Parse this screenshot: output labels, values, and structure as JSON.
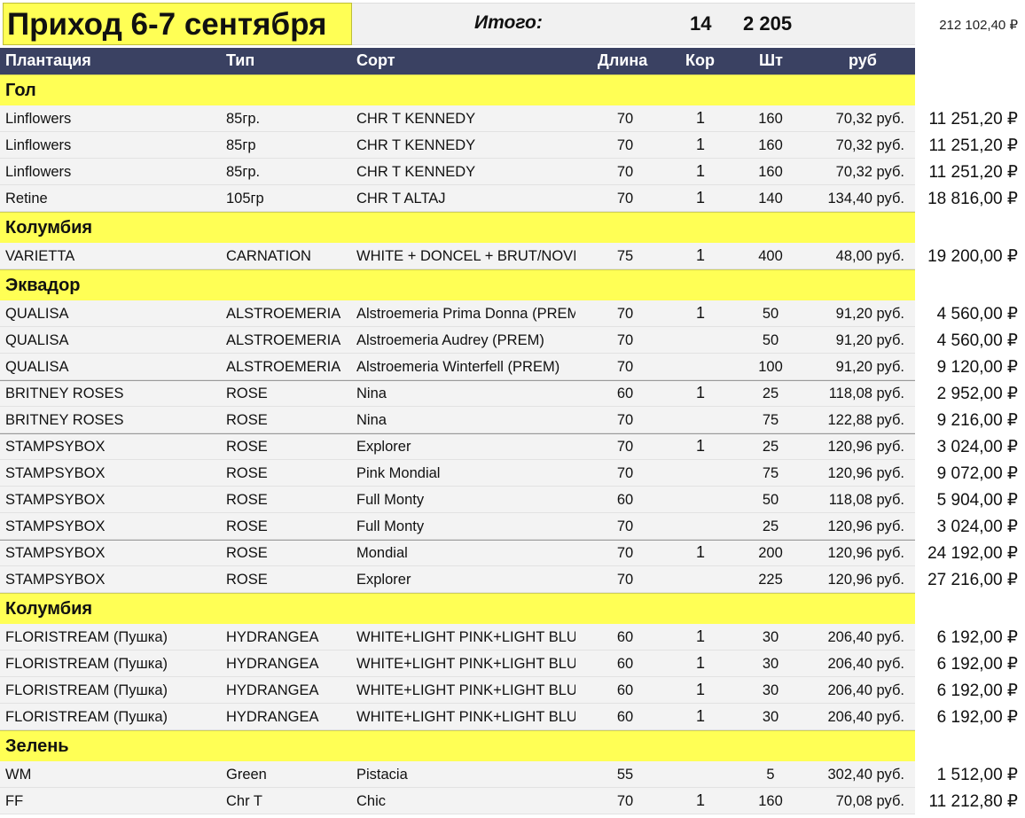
{
  "title": "Приход 6-7 сентября",
  "totals": {
    "label": "Итого:",
    "kor": "14",
    "sht": "2 205",
    "sum": "212 102,40 ₽"
  },
  "columns": {
    "plantation": "Плантация",
    "type": "Тип",
    "sort": "Сорт",
    "length": "Длина",
    "kor": "Кор",
    "sht": "Шт",
    "rub": "руб"
  },
  "sections": [
    {
      "group": "Гол",
      "rows": [
        {
          "plantation": "Linflowers",
          "type": "85гр.",
          "sort": "CHR T KENNEDY",
          "length": "70",
          "kor": "1",
          "sht": "160",
          "price": "70,32 руб.",
          "total": "11 251,20 ₽",
          "sep": false
        },
        {
          "plantation": "Linflowers",
          "type": "85гр",
          "sort": "CHR T KENNEDY",
          "length": "70",
          "kor": "1",
          "sht": "160",
          "price": "70,32 руб.",
          "total": "11 251,20 ₽",
          "sep": false
        },
        {
          "plantation": "Linflowers",
          "type": "85гр.",
          "sort": "CHR T KENNEDY",
          "length": "70",
          "kor": "1",
          "sht": "160",
          "price": "70,32 руб.",
          "total": "11 251,20 ₽",
          "sep": false
        },
        {
          "plantation": "Retine",
          "type": "105гр",
          "sort": "CHR T ALTAJ",
          "length": "70",
          "kor": "1",
          "sht": "140",
          "price": "134,40 руб.",
          "total": "18 816,00 ₽",
          "sep": false
        }
      ]
    },
    {
      "group": "Колумбия",
      "rows": [
        {
          "plantation": "VARIETTA",
          "type": "CARNATION",
          "sort": "WHITE + DONCEL + BRUT/NOVIA",
          "length": "75",
          "kor": "1",
          "sht": "400",
          "price": "48,00 руб.",
          "total": "19 200,00 ₽",
          "sep": false
        }
      ]
    },
    {
      "group": "Эквадор",
      "rows": [
        {
          "plantation": "QUALISA",
          "type": "ALSTROEMERIA",
          "sort": "Alstroemeria Prima Donna (PREM)",
          "length": "70",
          "kor": "1",
          "sht": "50",
          "price": "91,20 руб.",
          "total": "4 560,00 ₽",
          "sep": false
        },
        {
          "plantation": "QUALISA",
          "type": "ALSTROEMERIA",
          "sort": "Alstroemeria Audrey (PREM)",
          "length": "70",
          "kor": "",
          "sht": "50",
          "price": "91,20 руб.",
          "total": "4 560,00 ₽",
          "sep": false
        },
        {
          "plantation": "QUALISA",
          "type": "ALSTROEMERIA",
          "sort": "Alstroemeria Winterfell (PREM)",
          "length": "70",
          "kor": "",
          "sht": "100",
          "price": "91,20 руб.",
          "total": "9 120,00 ₽",
          "sep": false
        },
        {
          "plantation": "BRITNEY ROSES",
          "type": "ROSE",
          "sort": "Nina",
          "length": "60",
          "kor": "1",
          "sht": "25",
          "price": "118,08 руб.",
          "total": "2 952,00 ₽",
          "sep": true
        },
        {
          "plantation": "BRITNEY ROSES",
          "type": "ROSE",
          "sort": "Nina",
          "length": "70",
          "kor": "",
          "sht": "75",
          "price": "122,88 руб.",
          "total": "9 216,00 ₽",
          "sep": false
        },
        {
          "plantation": "STAMPSYBOX",
          "type": "ROSE",
          "sort": "Explorer",
          "length": "70",
          "kor": "1",
          "sht": "25",
          "price": "120,96 руб.",
          "total": "3 024,00 ₽",
          "sep": true
        },
        {
          "plantation": "STAMPSYBOX",
          "type": "ROSE",
          "sort": "Pink Mondial",
          "length": "70",
          "kor": "",
          "sht": "75",
          "price": "120,96 руб.",
          "total": "9 072,00 ₽",
          "sep": false
        },
        {
          "plantation": "STAMPSYBOX",
          "type": "ROSE",
          "sort": "Full Monty",
          "length": "60",
          "kor": "",
          "sht": "50",
          "price": "118,08 руб.",
          "total": "5 904,00 ₽",
          "sep": false
        },
        {
          "plantation": "STAMPSYBOX",
          "type": "ROSE",
          "sort": "Full Monty",
          "length": "70",
          "kor": "",
          "sht": "25",
          "price": "120,96 руб.",
          "total": "3 024,00 ₽",
          "sep": false
        },
        {
          "plantation": "STAMPSYBOX",
          "type": "ROSE",
          "sort": "Mondial",
          "length": "70",
          "kor": "1",
          "sht": "200",
          "price": "120,96 руб.",
          "total": "24 192,00 ₽",
          "sep": true
        },
        {
          "plantation": "STAMPSYBOX",
          "type": "ROSE",
          "sort": "Explorer",
          "length": "70",
          "kor": "",
          "sht": "225",
          "price": "120,96 руб.",
          "total": "27 216,00 ₽",
          "sep": false
        }
      ]
    },
    {
      "group": "Колумбия",
      "rows": [
        {
          "plantation": "FLORISTREAM (Пушка)",
          "type": "HYDRANGEA",
          "sort": "WHITE+LIGHT PINK+LIGHT BLUE",
          "length": "60",
          "kor": "1",
          "sht": "30",
          "price": "206,40 руб.",
          "total": "6 192,00 ₽",
          "sep": false
        },
        {
          "plantation": "FLORISTREAM (Пушка)",
          "type": "HYDRANGEA",
          "sort": "WHITE+LIGHT PINK+LIGHT BLUE",
          "length": "60",
          "kor": "1",
          "sht": "30",
          "price": "206,40 руб.",
          "total": "6 192,00 ₽",
          "sep": false
        },
        {
          "plantation": "FLORISTREAM (Пушка)",
          "type": "HYDRANGEA",
          "sort": "WHITE+LIGHT PINK+LIGHT BLUE",
          "length": "60",
          "kor": "1",
          "sht": "30",
          "price": "206,40 руб.",
          "total": "6 192,00 ₽",
          "sep": false
        },
        {
          "plantation": "FLORISTREAM (Пушка)",
          "type": "HYDRANGEA",
          "sort": "WHITE+LIGHT PINK+LIGHT BLUE",
          "length": "60",
          "kor": "1",
          "sht": "30",
          "price": "206,40 руб.",
          "total": "6 192,00 ₽",
          "sep": false
        }
      ]
    },
    {
      "group": "Зелень",
      "rows": [
        {
          "plantation": "WM",
          "type": "Green",
          "sort": "Pistacia",
          "length": "55",
          "kor": "",
          "sht": "5",
          "price": "302,40 руб.",
          "total": "1 512,00 ₽",
          "sep": false
        },
        {
          "plantation": "FF",
          "type": "Chr T",
          "sort": "Chic",
          "length": "70",
          "kor": "1",
          "sht": "160",
          "price": "70,08 руб.",
          "total": "11 212,80 ₽",
          "sep": false
        }
      ]
    }
  ]
}
